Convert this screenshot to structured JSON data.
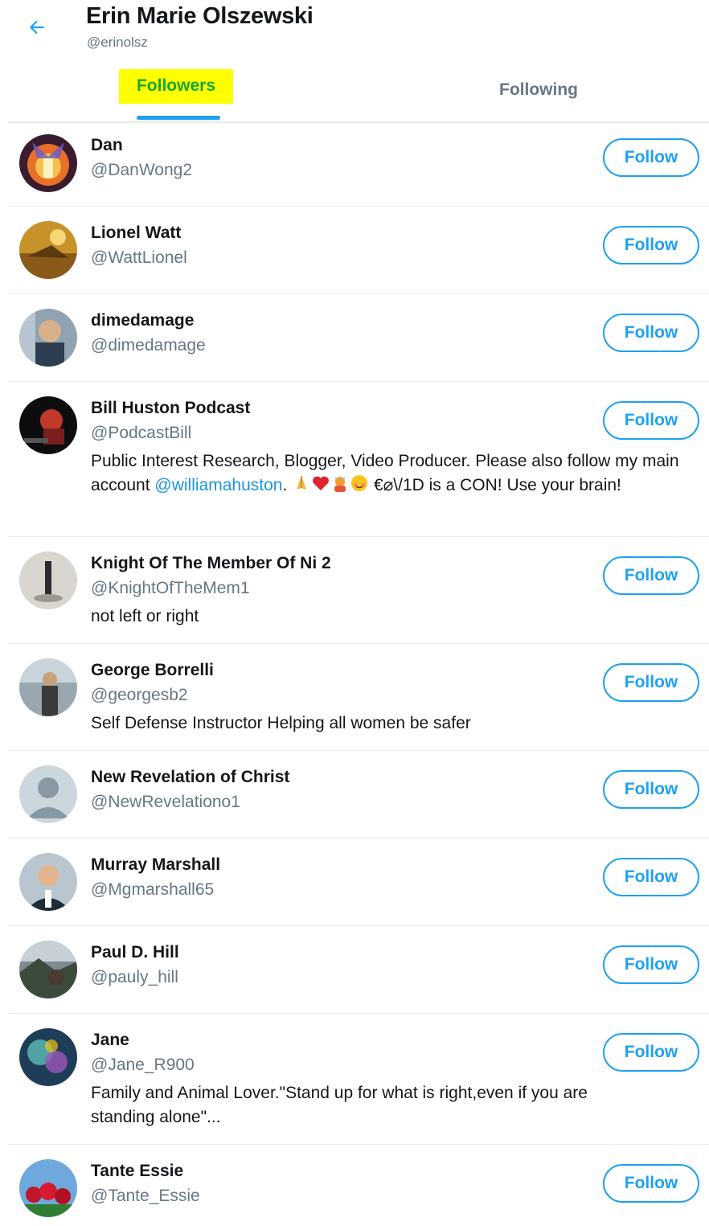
{
  "profile": {
    "name": "Erin Marie Olszewski",
    "handle": "@erinolsz"
  },
  "tabs": [
    {
      "label": "Followers",
      "active": true,
      "highlighted": true
    },
    {
      "label": "Following",
      "active": false
    }
  ],
  "follow_label": "Follow",
  "accent_color": "#1da1f2",
  "users": [
    {
      "name": "Dan",
      "handle": "@DanWong2"
    },
    {
      "name": "Lionel Watt",
      "handle": "@WattLionel"
    },
    {
      "name": "dimedamage",
      "handle": "@dimedamage"
    },
    {
      "name": "Bill Huston Podcast",
      "handle": "@PodcastBill",
      "bio_part1": "Public Interest Research, Blogger, Video Producer. Please also follow my main account ",
      "bio_mention": "@williamahuston",
      "bio_part2": ". ",
      "bio_part3": " €⌀\\/1D is a CON! Use your brain!"
    },
    {
      "name": "Knight Of The Member Of Ni 2",
      "handle": "@KnightOfTheMem1",
      "bio": "not left or right"
    },
    {
      "name": "George Borrelli",
      "handle": "@georgesb2",
      "bio": "Self Defense Instructor Helping all women be safer"
    },
    {
      "name": "New Revelation of Christ",
      "handle": "@NewRevelationo1"
    },
    {
      "name": "Murray Marshall",
      "handle": "@Mgmarshall65"
    },
    {
      "name": "Paul D. Hill",
      "handle": "@pauly_hill"
    },
    {
      "name": "Jane",
      "handle": "@Jane_R900",
      "bio": "Family and Animal Lover.\"Stand up for what is right,even if you are standing alone\"..."
    },
    {
      "name": "Tante Essie",
      "handle": "@Tante_Essie"
    }
  ]
}
